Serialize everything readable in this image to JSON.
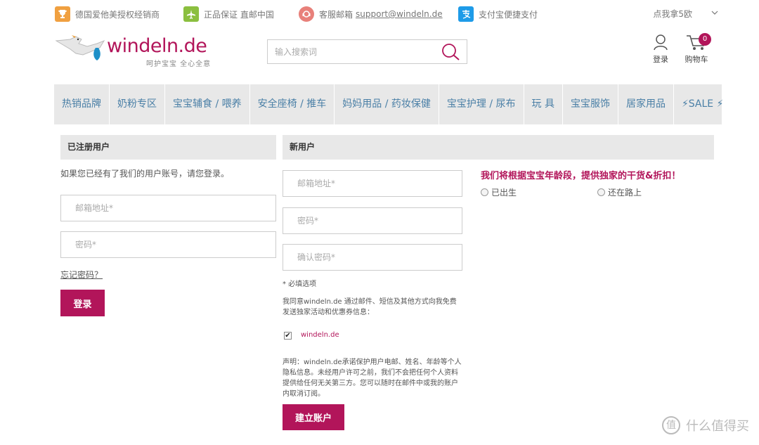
{
  "topbar": {
    "items": [
      {
        "icon": "trophy-icon",
        "text": "德国爱他美授权经销商",
        "color": "#f0a040"
      },
      {
        "icon": "plane-icon",
        "text": "正品保证 直邮中国",
        "color": "#8bbf3f"
      },
      {
        "icon": "headset-icon",
        "text": "客服邮箱",
        "link": "support@windeln.de",
        "color": "#e8807a"
      },
      {
        "icon": "alipay-icon",
        "text": "支付宝便捷支付",
        "color": "#1e9be8"
      }
    ],
    "region": "点我拿5欧"
  },
  "header": {
    "logo_text": "windeln.de",
    "logo_sub": "呵护宝宝 全心全意",
    "search_placeholder": "输入搜索词",
    "login_label": "登录",
    "cart_label": "购物车",
    "cart_count": "0"
  },
  "nav": [
    "热销品牌",
    "奶粉专区",
    "宝宝辅食 / 喂养",
    "安全座椅 / 推车",
    "妈妈用品 / 药妆保健",
    "宝宝护理 / 尿布",
    "玩 具",
    "宝宝服饰",
    "居家用品",
    "⚡SALE ⚡"
  ],
  "registered": {
    "title": "已注册用户",
    "intro": "如果您已经有了我们的用户账号，请您登录。",
    "email_placeholder": "邮箱地址*",
    "password_placeholder": "密码*",
    "forgot": "忘记密码？",
    "login_button": "登录"
  },
  "new_user": {
    "title": "新用户",
    "email_placeholder": "邮箱地址*",
    "password_placeholder": "密码*",
    "confirm_placeholder": "确认密码*",
    "required_note": "* 必填选项",
    "consent": "我同意windeln.de 通过邮件、短信及其他方式向我免费发送独家活动和优惠券信息：",
    "newsletter_logo": "windeln.de",
    "disclaimer": "声明：windeln.de承诺保护用户电邮、姓名、年龄等个人隐私信息。未经用户许可之前，我们不会把任何个人资料提供给任何无关第三方。您可以随时在邮件中或我的账户内取消订阅。",
    "create_button": "建立账户"
  },
  "promo": {
    "text": "我们将根据宝宝年龄段，提供独家的干货&折扣！",
    "options": [
      "已出生",
      "还在路上"
    ]
  },
  "watermark": {
    "badge": "值",
    "text": "什么值得买"
  },
  "colors": {
    "brand": "#b2155a",
    "nav_text": "#4a7fa6",
    "panel_bg": "#e8e8e8"
  }
}
